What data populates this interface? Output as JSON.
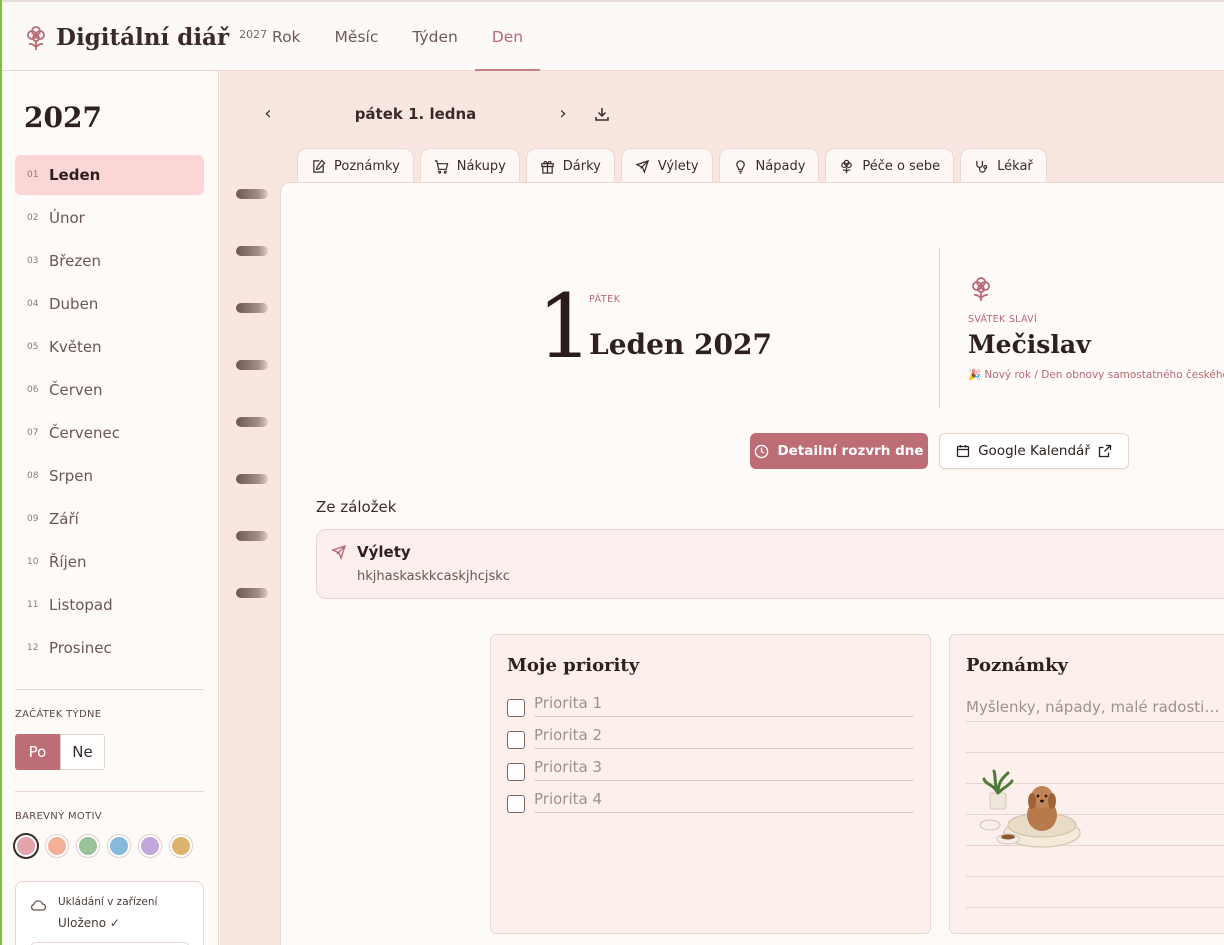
{
  "header": {
    "app_title": "Digitální diář",
    "year_badge": "2027",
    "nav": [
      {
        "label": "Rok"
      },
      {
        "label": "Měsíc"
      },
      {
        "label": "Týden"
      },
      {
        "label": "Den",
        "active": true
      }
    ]
  },
  "sidebar": {
    "year": "2027",
    "months": [
      {
        "num": "01",
        "name": "Leden",
        "active": true
      },
      {
        "num": "02",
        "name": "Únor"
      },
      {
        "num": "03",
        "name": "Březen"
      },
      {
        "num": "04",
        "name": "Duben"
      },
      {
        "num": "05",
        "name": "Květen"
      },
      {
        "num": "06",
        "name": "Červen"
      },
      {
        "num": "07",
        "name": "Červenec"
      },
      {
        "num": "08",
        "name": "Srpen"
      },
      {
        "num": "09",
        "name": "Září"
      },
      {
        "num": "10",
        "name": "Říjen"
      },
      {
        "num": "11",
        "name": "Listopad"
      },
      {
        "num": "12",
        "name": "Prosinec"
      }
    ],
    "week_start_label": "ZAČÁTEK TÝDNE",
    "week_start_options": [
      "Po",
      "Ne"
    ],
    "week_start_selected": "Po",
    "theme_label": "BAREVNÝ MOTIV",
    "theme_colors": [
      "#e5a3ab",
      "#f2b097",
      "#9cc19a",
      "#86b9da",
      "#c3a6dc",
      "#dcb46c"
    ],
    "save_title": "Ukládání v zařízení",
    "save_status": "Uloženo ✓"
  },
  "main": {
    "date_label": "pátek 1. ledna",
    "prev_icon": "chevron-left-icon",
    "next_icon": "chevron-right-icon",
    "download_icon": "download-icon",
    "tabs": [
      {
        "label": "Poznámky",
        "icon": "note-edit-icon"
      },
      {
        "label": "Nákupy",
        "icon": "cart-icon"
      },
      {
        "label": "Dárky",
        "icon": "gift-icon"
      },
      {
        "label": "Výlety",
        "icon": "plane-icon"
      },
      {
        "label": "Nápady",
        "icon": "lightbulb-icon"
      },
      {
        "label": "Péče o sebe",
        "icon": "flower-icon"
      },
      {
        "label": "Lékař",
        "icon": "stethoscope-icon"
      }
    ],
    "day": {
      "number": "1",
      "weekday": "PÁTEK",
      "month_year": "Leden 2027"
    },
    "nameday": {
      "label": "SVÁTEK SLAVÍ",
      "name": "Mečislav",
      "holiday": "🎉 Nový rok / Den obnovy samostatného českého s"
    },
    "buttons": {
      "schedule": "Detailní rozvrh dne",
      "google": "Google Kalendář"
    },
    "bookmarks_title": "Ze záložek",
    "bookmark": {
      "title": "Výlety",
      "text": "hkjhaskaskkcaskjhcjskc"
    },
    "priorities": {
      "title": "Moje priority",
      "items": [
        "Priorita 1",
        "Priorita 2",
        "Priorita 3",
        "Priorita 4"
      ]
    },
    "notes": {
      "title": "Poznámky",
      "placeholder": "Myšlenky, nápady, malé radosti…"
    }
  },
  "colors": {
    "accent": "#bd6d76",
    "active_month_bg": "#fcd6d6",
    "main_bg": "#fae6e1"
  }
}
